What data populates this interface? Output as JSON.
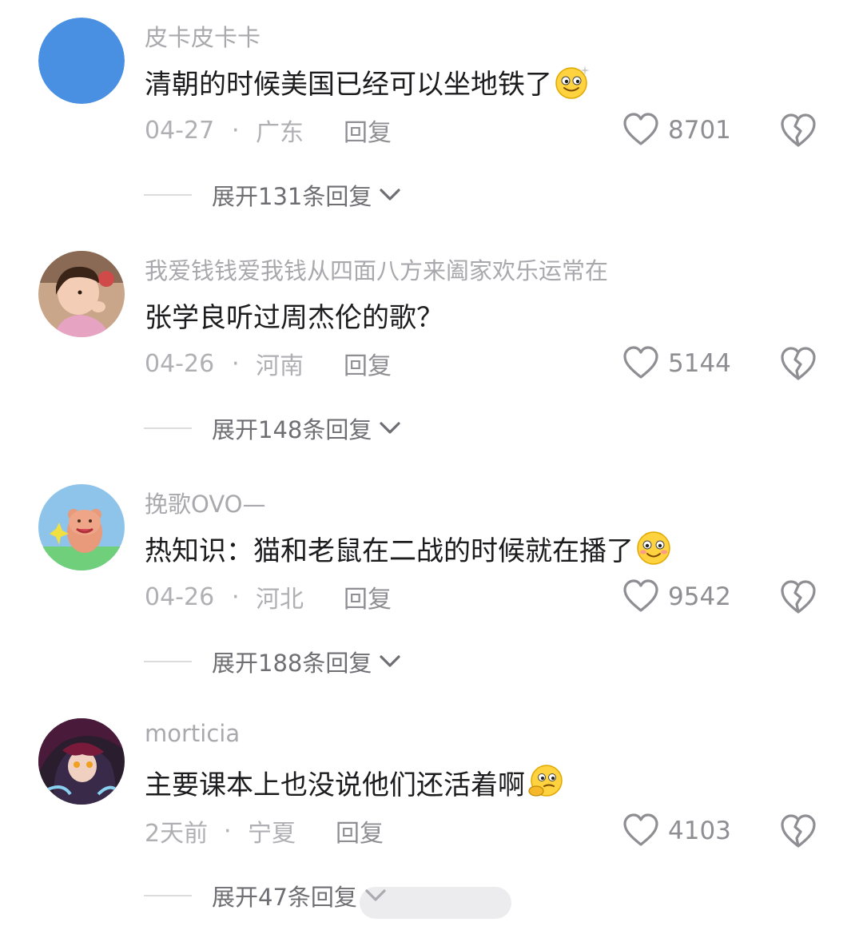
{
  "comments": [
    {
      "username": "皮卡皮卡卡",
      "text": "清朝的时候美国已经可以坐地铁了",
      "emoji": "sparkle-smile-emoji",
      "date": "04-27",
      "separator": "·",
      "region": "广东",
      "reply_label": "回复",
      "likes": "8701",
      "expand_label": "展开131条回复"
    },
    {
      "username": "我爱钱钱爱我钱从四面八方来阖家欢乐运常在",
      "text": "张学良听过周杰伦的歌？",
      "emoji": "",
      "date": "04-26",
      "separator": "·",
      "region": "河南",
      "reply_label": "回复",
      "likes": "5144",
      "expand_label": "展开148条回复"
    },
    {
      "username": "挽歌OVO—",
      "text": "热知识：猫和老鼠在二战的时候就在播了",
      "emoji": "blush-smile-emoji",
      "date": "04-26",
      "separator": "·",
      "region": "河北",
      "reply_label": "回复",
      "likes": "9542",
      "expand_label": "展开188条回复"
    },
    {
      "username": "morticia",
      "text": "主要课本上也没说他们还活着啊",
      "emoji": "thinking-face-emoji",
      "date": "2天前",
      "separator": "·",
      "region": "宁夏",
      "reply_label": "回复",
      "likes": "4103",
      "expand_label": "展开47条回复"
    }
  ],
  "colors": {
    "username": "#a9a9ad",
    "text": "#1c1c1e",
    "meta": "#b0b0b4",
    "expand": "#6e6e73",
    "avatar_blue": "#4a90e2"
  },
  "icons": {
    "like": "heart-outline-icon",
    "dislike": "broken-heart-icon",
    "expand": "chevron-down-icon"
  }
}
